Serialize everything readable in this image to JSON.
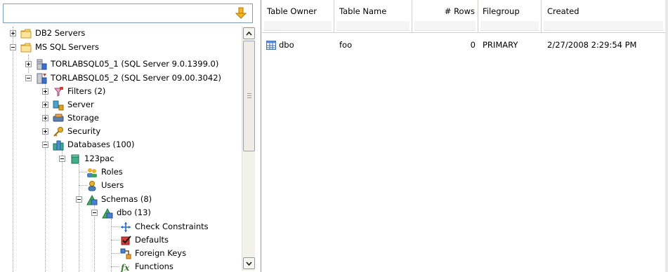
{
  "filter": {
    "value": ""
  },
  "tree": [
    {
      "label": "DB2 Servers",
      "level": 0,
      "expander": "plus",
      "icon": "folder-icon"
    },
    {
      "label": "MS SQL Servers",
      "level": 0,
      "expander": "minus",
      "icon": "folder-icon"
    },
    {
      "label": "TORLABSQL05_1 (SQL Server 9.0.1399.0)",
      "level": 1,
      "expander": "plus",
      "icon": "server-icon"
    },
    {
      "label": "TORLABSQL05_2 (SQL Server 09.00.3042)",
      "level": 1,
      "expander": "minus",
      "icon": "server-active-icon"
    },
    {
      "label": "Filters (2)",
      "level": 2,
      "expander": "plus",
      "icon": "filter-icon"
    },
    {
      "label": "Server",
      "level": 2,
      "expander": "plus",
      "icon": "server-node-icon"
    },
    {
      "label": "Storage",
      "level": 2,
      "expander": "plus",
      "icon": "storage-icon"
    },
    {
      "label": "Security",
      "level": 2,
      "expander": "plus",
      "icon": "key-icon"
    },
    {
      "label": "Databases (100)",
      "level": 2,
      "expander": "minus",
      "icon": "databases-icon"
    },
    {
      "label": "123pac",
      "level": 3,
      "expander": "minus",
      "icon": "database-icon"
    },
    {
      "label": "Roles",
      "level": 4,
      "expander": "none",
      "icon": "roles-icon"
    },
    {
      "label": "Users",
      "level": 4,
      "expander": "none",
      "icon": "user-icon"
    },
    {
      "label": "Schemas (8)",
      "level": 4,
      "expander": "minus",
      "icon": "schemas-icon"
    },
    {
      "label": "dbo (13)",
      "level": 5,
      "expander": "minus",
      "icon": "schema-icon"
    },
    {
      "label": "Check Constraints",
      "level": 6,
      "expander": "none",
      "icon": "check-constraints-icon"
    },
    {
      "label": "Defaults",
      "level": 6,
      "expander": "none",
      "icon": "defaults-icon"
    },
    {
      "label": "Foreign Keys",
      "level": 6,
      "expander": "none",
      "icon": "foreign-keys-icon"
    },
    {
      "label": "Functions",
      "level": 6,
      "expander": "none",
      "icon": "functions-icon"
    }
  ],
  "grid": {
    "columns": [
      "Table Owner",
      "Table Name",
      "# Rows",
      "Filegroup",
      "Created"
    ],
    "rows": [
      {
        "owner": "dbo",
        "name": "foo",
        "rows": "0",
        "filegroup": "PRIMARY",
        "created": "2/27/2008 2:29:54 PM"
      }
    ]
  },
  "colors": {
    "pane_border": "#9a9a9a",
    "tree_lines": "#a0a0a0",
    "header_separator": "#d4d0c8"
  }
}
